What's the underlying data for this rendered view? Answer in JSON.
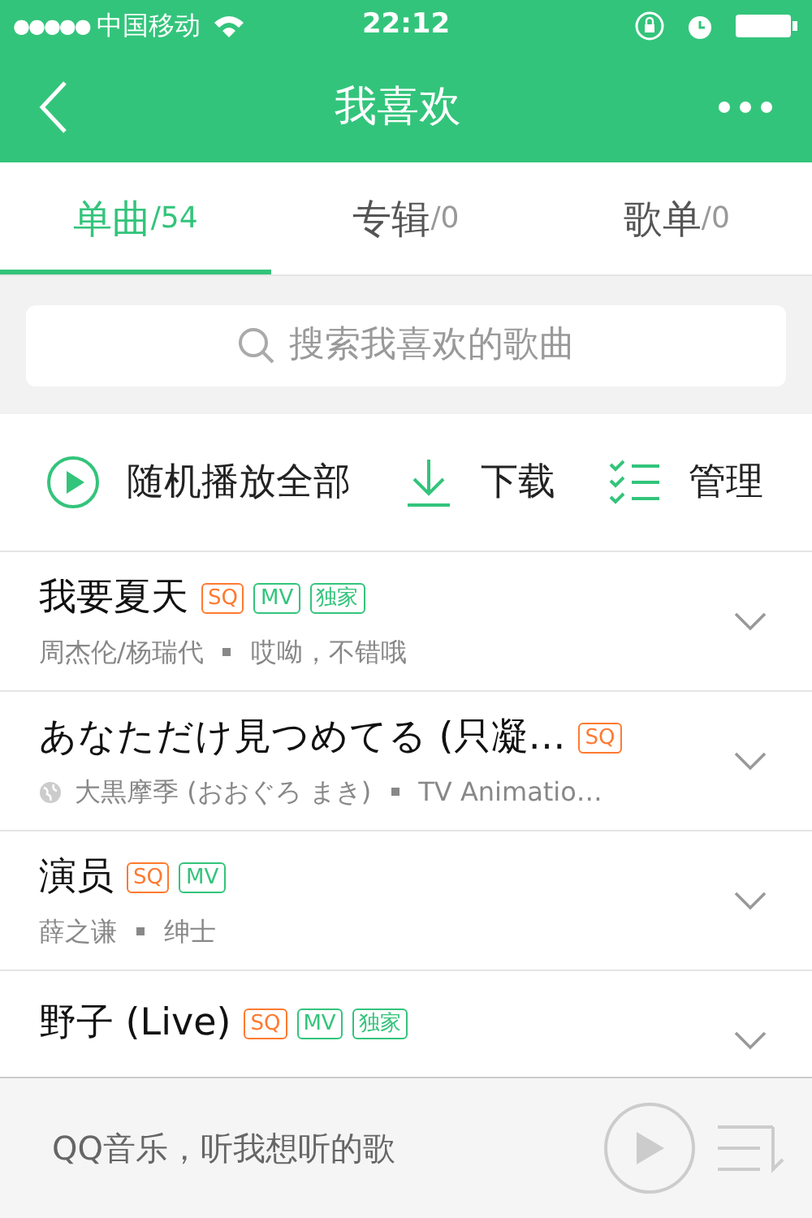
{
  "status_bar": {
    "signal_dots": "●●●●●",
    "carrier": "中国移动",
    "time": "22:12"
  },
  "nav": {
    "title": "我喜欢"
  },
  "tabs": [
    {
      "label": "单曲",
      "count": "/54",
      "selected": true
    },
    {
      "label": "专辑",
      "count": "/0",
      "selected": false
    },
    {
      "label": "歌单",
      "count": "/0",
      "selected": false
    }
  ],
  "search": {
    "placeholder": "搜索我喜欢的歌曲"
  },
  "actions": [
    {
      "kind": "shuffle",
      "label": "随机播放全部"
    },
    {
      "kind": "download",
      "label": "下载"
    },
    {
      "kind": "manage",
      "label": "管理"
    }
  ],
  "songs": [
    {
      "title": "我要夏天",
      "tags": [
        {
          "kind": "sq",
          "label": "SQ"
        },
        {
          "kind": "mv",
          "label": "MV"
        },
        {
          "kind": "exclusive",
          "label": "独家"
        }
      ],
      "globe": false,
      "artist": "周杰伦/杨瑞代",
      "album": "哎呦，不错哦"
    },
    {
      "title": "あなただけ見つめてる (只凝…",
      "tags": [
        {
          "kind": "sq",
          "label": "SQ"
        }
      ],
      "globe": true,
      "artist": "大黒摩季 (おおぐろ まき)",
      "album": "TV Animatio…"
    },
    {
      "title": "演员",
      "tags": [
        {
          "kind": "sq",
          "label": "SQ"
        },
        {
          "kind": "mv",
          "label": "MV"
        }
      ],
      "globe": false,
      "artist": "薛之谦",
      "album": "绅士"
    },
    {
      "title": "野子 (Live)",
      "tags": [
        {
          "kind": "sq",
          "label": "SQ"
        },
        {
          "kind": "mv",
          "label": "MV"
        },
        {
          "kind": "exclusive",
          "label": "独家"
        }
      ]
    }
  ],
  "player": {
    "slogan": "QQ音乐，听我想听的歌"
  }
}
